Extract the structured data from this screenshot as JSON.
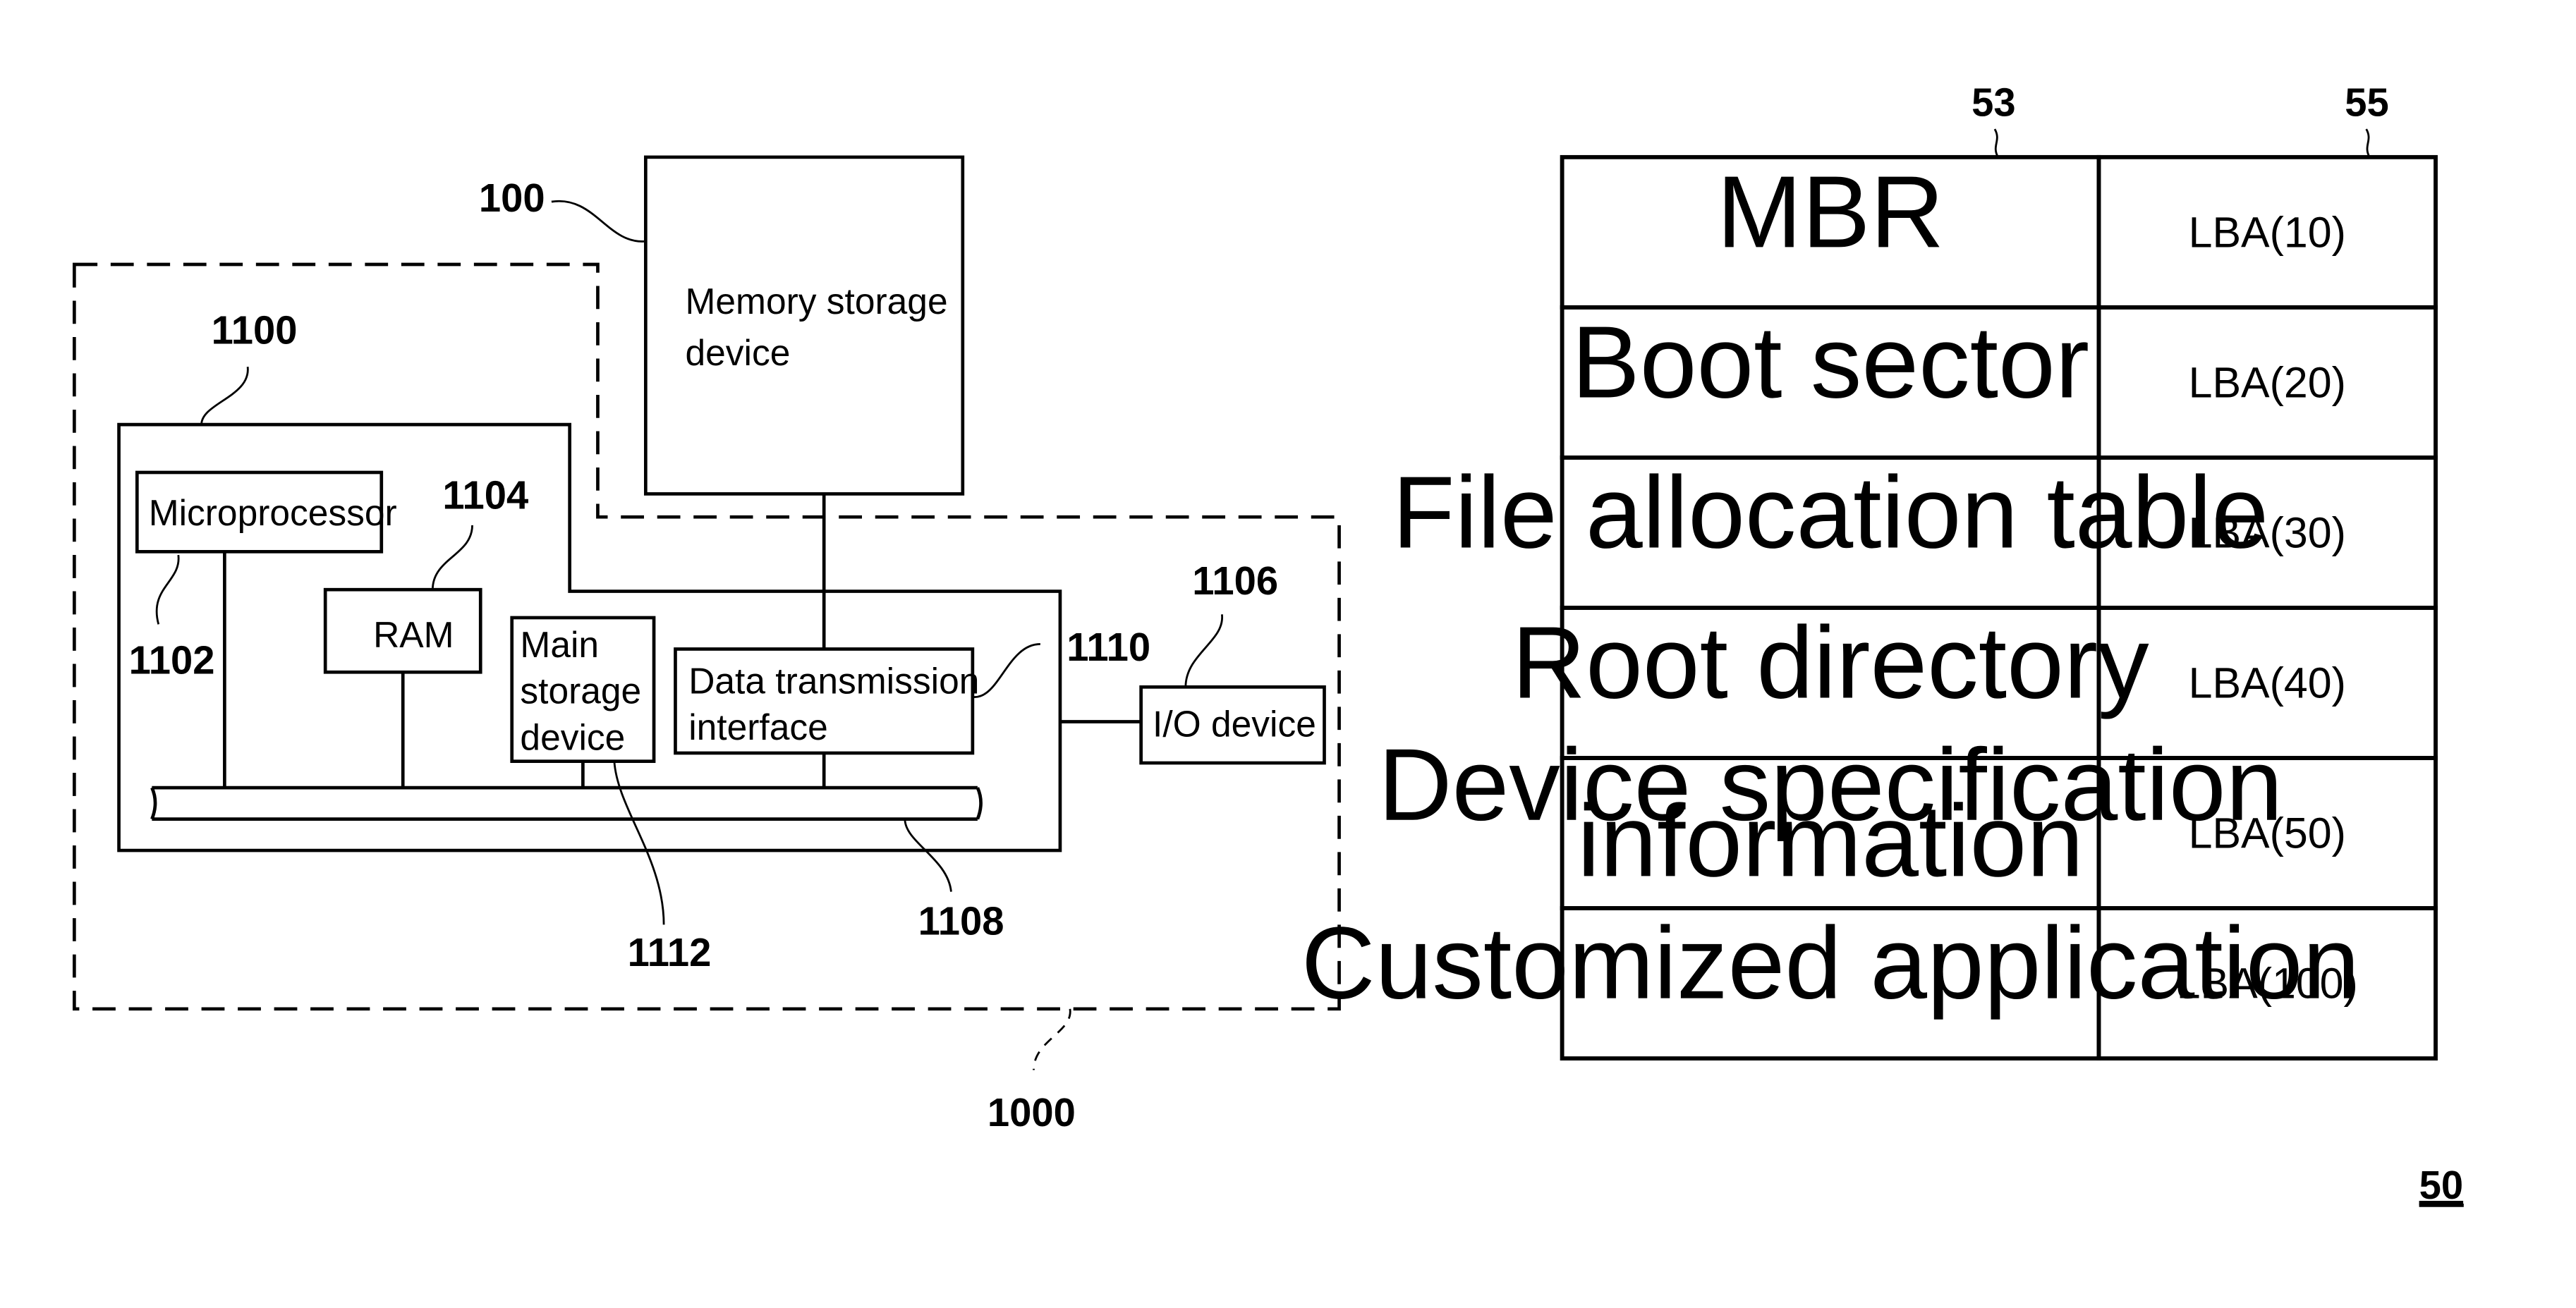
{
  "figure": {
    "label": "50",
    "left_diagram": {
      "system_ref": "1000",
      "memory_storage_device": {
        "ref": "100",
        "lines": [
          "Memory storage",
          "device"
        ]
      },
      "host": {
        "ref": "1100",
        "microprocessor": {
          "ref": "1102",
          "label": "Microprocessor"
        },
        "ram": {
          "ref": "1104",
          "label": "RAM"
        },
        "main_storage": {
          "ref": "1112",
          "lines": [
            "Main",
            "storage",
            "device"
          ]
        },
        "data_interface": {
          "ref": "1110",
          "lines": [
            "Data transmission",
            "interface"
          ]
        },
        "bus": {
          "ref": "1108"
        }
      },
      "io_device": {
        "ref": "1106",
        "label": "I/O device"
      }
    },
    "table": {
      "column_refs": [
        "53",
        "55"
      ],
      "rows": [
        {
          "name": [
            "MBR"
          ],
          "address": "LBA(10)"
        },
        {
          "name": [
            "Boot sector"
          ],
          "address": "LBA(20)"
        },
        {
          "name": [
            "File allocation table"
          ],
          "address": "LBA(30)"
        },
        {
          "name": [
            "Root directory"
          ],
          "address": "LBA(40)"
        },
        {
          "name": [
            "Device specification",
            "information"
          ],
          "address": "LBA(50)"
        },
        {
          "name": [
            "Customized application"
          ],
          "address": "LBA(100)"
        }
      ]
    }
  }
}
